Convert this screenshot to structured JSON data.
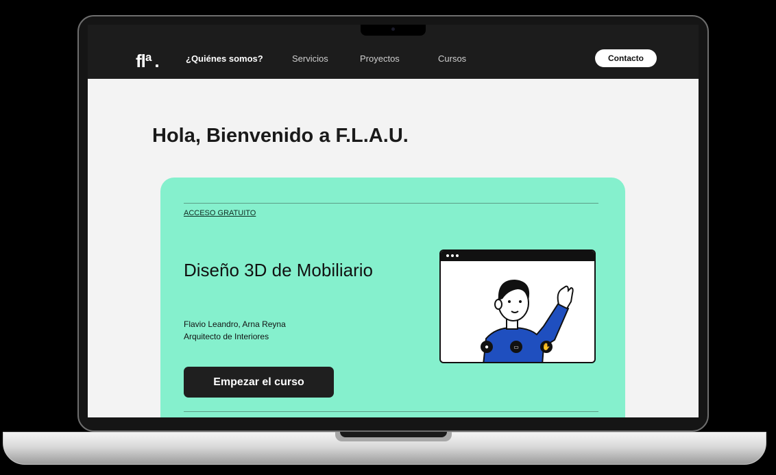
{
  "nav": {
    "logo": "flª",
    "links": [
      "¿Quiénes somos?",
      "Servicios",
      "Proyectos",
      "Cursos"
    ],
    "contact": "Contacto"
  },
  "hero": {
    "title": "Hola, Bienvenido a F.L.A.U."
  },
  "course": {
    "badge": "ACCESO GRATUITO",
    "title": "Diseño 3D de Mobiliario",
    "authors": "Flavio Leandro, Arna Reyna",
    "role": "Arquitecto de Interiores",
    "cta": "Empezar el curso"
  },
  "icons": [
    "microphone-icon",
    "camera-icon",
    "raise-hand-icon"
  ],
  "colors": {
    "accent": "#85f0cd",
    "nav": "#1c1c1c",
    "button": "#1f1f1f"
  }
}
